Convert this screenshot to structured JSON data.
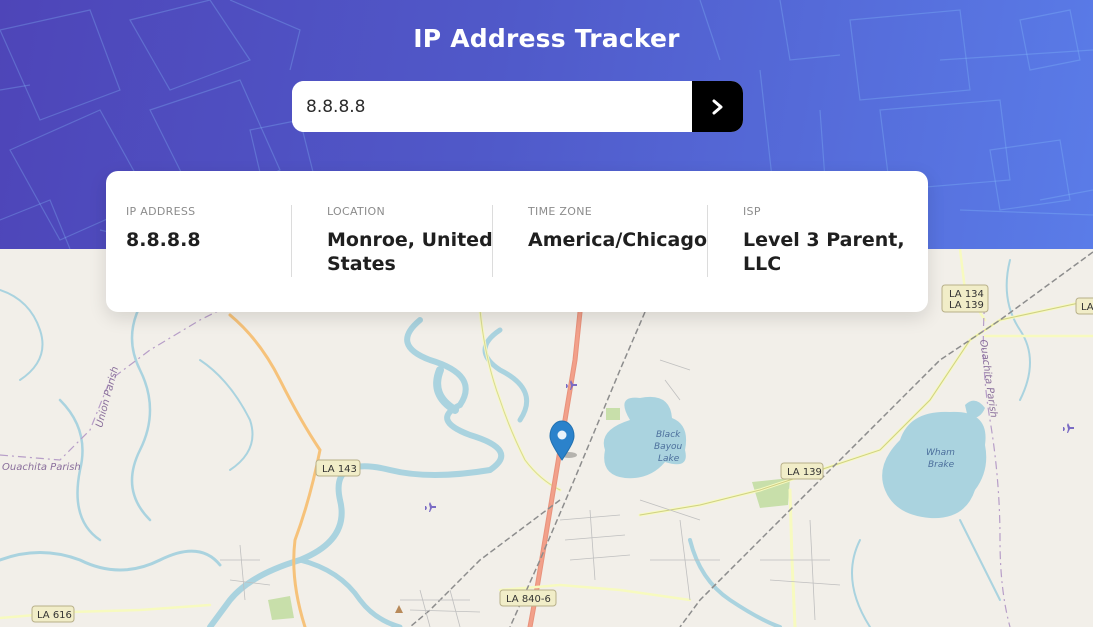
{
  "header": {
    "title": "IP Address Tracker"
  },
  "search": {
    "value": "8.8.8.8",
    "button_icon": "chevron-right-icon"
  },
  "info": {
    "ip": {
      "label": "IP ADDRESS",
      "value": "8.8.8.8"
    },
    "location": {
      "label": "LOCATION",
      "value_line1": "Monroe, United",
      "value_line2": "States"
    },
    "timezone": {
      "label": "TIME ZONE",
      "value": "America/Chicago"
    },
    "isp": {
      "label": "ISP",
      "value_line1": "Level 3 Parent,",
      "value_line2": "LLC"
    }
  },
  "map": {
    "road_labels": [
      "LA 134",
      "LA 139",
      "LA 143",
      "LA 139",
      "LA 616",
      "LA 840-6",
      "LA"
    ],
    "place_labels": [
      "Union Parish",
      "Ouachita Parish",
      "Ouachita Parish"
    ],
    "lake_labels": {
      "black_bayou": [
        "Black",
        "Bayou",
        "Lake"
      ],
      "wham_brake": [
        "Wham",
        "Brake"
      ]
    },
    "marker_icon": "location-pin-icon"
  },
  "colors": {
    "header_start": "#4e45b8",
    "header_end": "#5a7ce8",
    "button_bg": "#000000",
    "card_bg": "#ffffff",
    "marker": "#2b82cb",
    "water": "#aad3df",
    "map_bg": "#f2efe9"
  }
}
